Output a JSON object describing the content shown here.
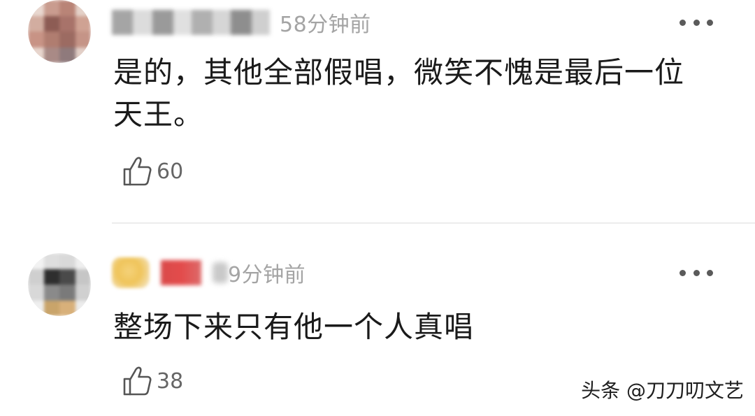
{
  "comments": [
    {
      "time": "58分钟前",
      "text_lines": [
        "是的，其他全部假唱，微笑不愧是最后一位",
        "天王。"
      ],
      "likes": "60",
      "avatar_icon": "blurred-avatar"
    },
    {
      "time_prefix": "9分钟前",
      "text_lines": [
        "整场下来只有他一个人真唱"
      ],
      "likes": "38",
      "avatar_icon": "blurred-avatar"
    }
  ],
  "more_icon": "more-dots-icon",
  "like_icon": "thumbs-up-icon",
  "watermark": "头条 @刀刀叨文艺",
  "colors": {
    "text": "#1a1a1a",
    "muted": "#a4a4a4",
    "count": "#666666",
    "divider": "#ececec"
  }
}
